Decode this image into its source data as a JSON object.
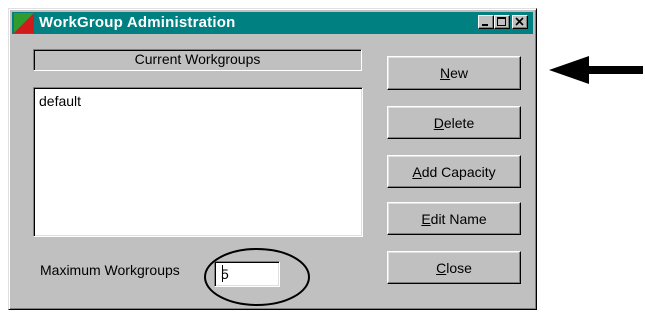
{
  "window": {
    "title": "WorkGroup Administration",
    "titlebar_color": "#008080",
    "caption_buttons": [
      "minimize-icon",
      "maximize-icon",
      "close-icon"
    ]
  },
  "workgroups": {
    "header": "Current Workgroups",
    "items": [
      "default"
    ]
  },
  "max_workgroups": {
    "label": "Maximum Workgroups",
    "value": "5"
  },
  "buttons": {
    "new": {
      "mnemonic": "N",
      "rest": "ew"
    },
    "delete": {
      "mnemonic": "D",
      "rest": "elete"
    },
    "add_capacity": {
      "mnemonic": "A",
      "rest": "dd Capacity"
    },
    "edit_name": {
      "mnemonic": "E",
      "rest": "dit Name"
    },
    "close": {
      "mnemonic": "C",
      "rest": "lose"
    }
  },
  "annotations": {
    "arrow": "arrow-left-icon",
    "ellipse": "highlight-ellipse"
  }
}
